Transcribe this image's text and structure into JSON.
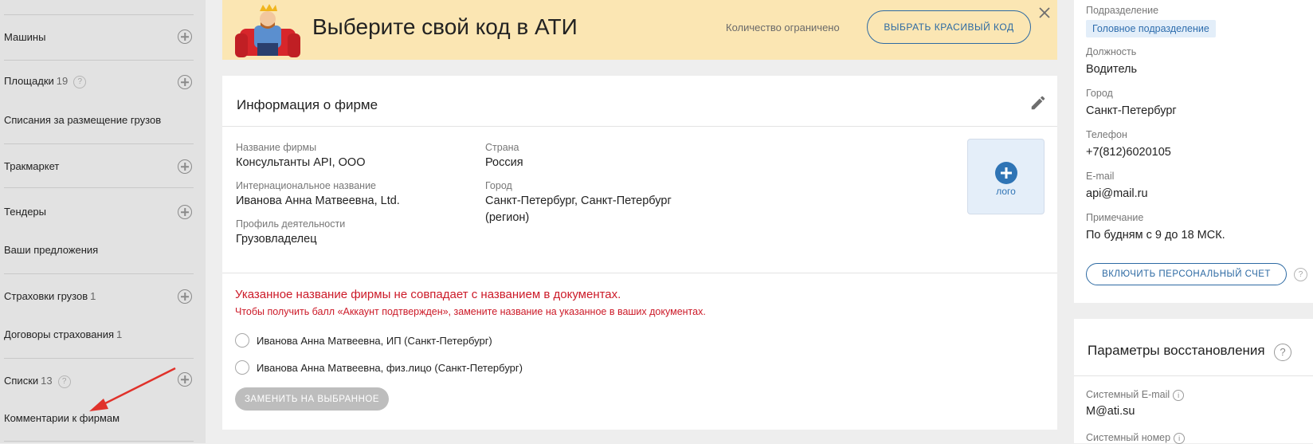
{
  "sidebar": {
    "items": [
      {
        "label": "Машины",
        "count": "",
        "help": false,
        "add": true
      },
      {
        "label": "Площадки",
        "count": "19",
        "help": true,
        "add": true
      },
      {
        "label": "Списания за размещение грузов",
        "count": "",
        "help": false,
        "add": false
      },
      {
        "label": "Тракмаркет",
        "count": "",
        "help": false,
        "add": true
      },
      {
        "label": "Тендеры",
        "count": "",
        "help": false,
        "add": true
      },
      {
        "label": "Ваши предложения",
        "count": "",
        "help": false,
        "add": false
      },
      {
        "label": "Страховки грузов",
        "count": "1",
        "help": false,
        "add": true
      },
      {
        "label": "Договоры страхования",
        "count": "1",
        "help": false,
        "add": false
      },
      {
        "label": "Списки",
        "count": "13",
        "help": true,
        "add": true
      },
      {
        "label": "Комментарии к фирмам",
        "count": "",
        "help": false,
        "add": false
      }
    ],
    "arrow_color": "#e0322b"
  },
  "banner": {
    "title": "Выберите свой код в АТИ",
    "note": "Количество ограничено",
    "button": "ВЫБРАТЬ КРАСИВЫЙ КОД",
    "close_icon": "close-icon"
  },
  "company": {
    "title": "Информация о фирме",
    "name_label": "Название фирмы",
    "name_value": "Консультанты API, ООО",
    "intl_label": "Интернациональное название",
    "intl_value": "Иванова Анна Матвеевна, Ltd.",
    "profile_label": "Профиль деятельности",
    "profile_value": "Грузовладелец",
    "country_label": "Страна",
    "country_value": "Россия",
    "city_label": "Город",
    "city_value_line1": "Санкт-Петербург, Санкт-Петербург",
    "city_value_line2": "(регион)",
    "logo_label": "лого",
    "warning_title": "Указанное название фирмы не совпадает с названием в документах.",
    "warning_sub": "Чтобы получить балл «Аккаунт подтвержден», замените название на указанное в ваших документах.",
    "options": [
      "Иванова Анна Матвеевна, ИП (Санкт-Петербург)",
      "Иванова Анна Матвеевна, физ.лицо (Санкт-Петербург)"
    ],
    "replace_button": "ЗАМЕНИТЬ НА ВЫБРАННОЕ"
  },
  "contact": {
    "department_label": "Подразделение",
    "department_value": "Головное подразделение",
    "position_label": "Должность",
    "position_value": "Водитель",
    "city_label": "Город",
    "city_value": "Санкт-Петербург",
    "phone_label": "Телефон",
    "phone_value": "+7(812)6020105",
    "email_label": "E-mail",
    "email_value": "api@mail.ru",
    "note_label": "Примечание",
    "note_value": "По будням с 9 до 18 МСК.",
    "personal_button": "ВКЛЮЧИТЬ ПЕРСОНАЛЬНЫЙ СЧЕТ"
  },
  "recovery": {
    "title": "Параметры восстановления",
    "sys_email_label": "Системный E-mail",
    "sys_email_value": "M@ati.su",
    "sys_number_label": "Системный номер"
  },
  "colors": {
    "accent": "#2d6aa3",
    "warning": "#cc1a28",
    "banner_bg": "#fbe6b3"
  }
}
